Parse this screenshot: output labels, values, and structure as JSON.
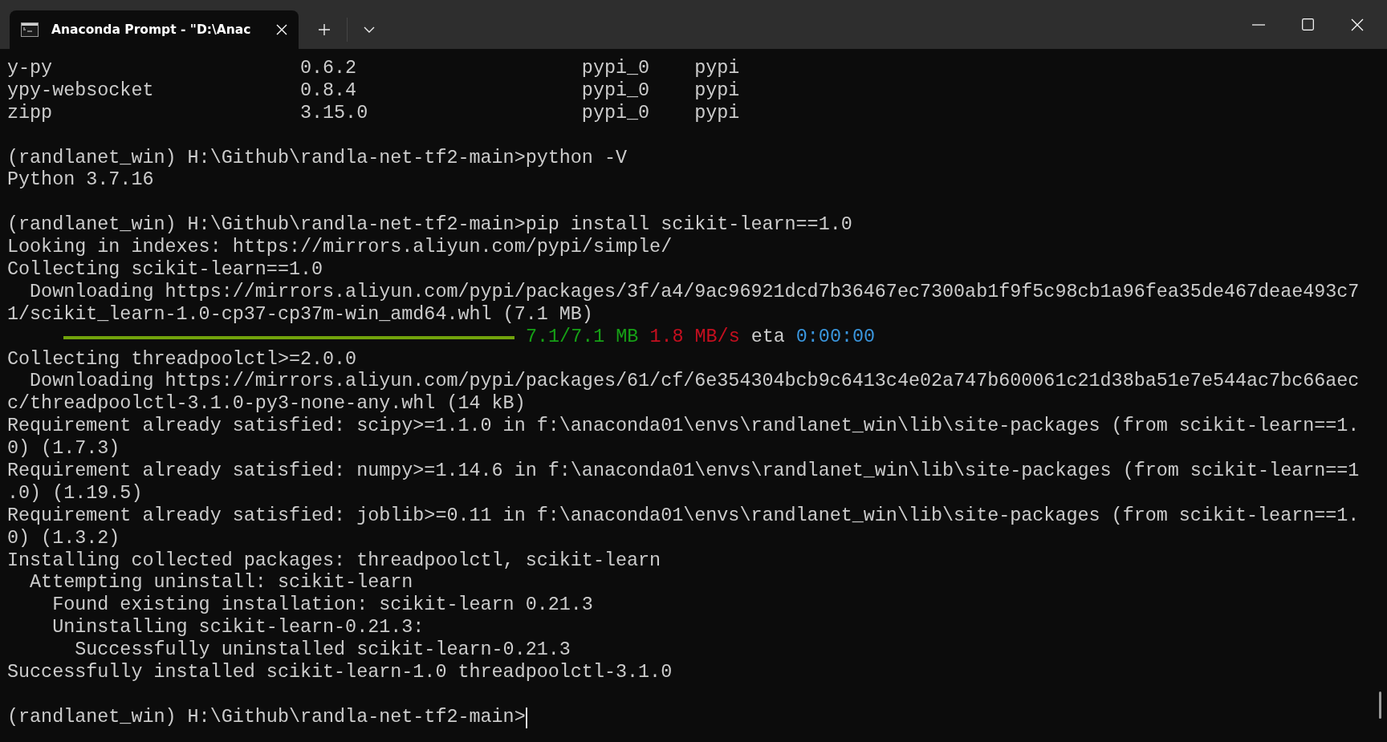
{
  "tabs": [
    {
      "title": "Anaconda Prompt - \"D:\\Anac",
      "selected": true
    }
  ],
  "terminal": {
    "lines": [
      {
        "kind": "text",
        "text": "y-py                      0.6.2                    pypi_0    pypi"
      },
      {
        "kind": "text",
        "text": "ypy-websocket             0.8.4                    pypi_0    pypi"
      },
      {
        "kind": "text",
        "text": "zipp                      3.15.0                   pypi_0    pypi"
      },
      {
        "kind": "blank"
      },
      {
        "kind": "text",
        "text": "(randlanet_win) H:\\Github\\randla-net-tf2-main>python -V"
      },
      {
        "kind": "text",
        "text": "Python 3.7.16"
      },
      {
        "kind": "blank"
      },
      {
        "kind": "text",
        "text": "(randlanet_win) H:\\Github\\randla-net-tf2-main>pip install scikit-learn==1.0"
      },
      {
        "kind": "text",
        "text": "Looking in indexes: https://mirrors.aliyun.com/pypi/simple/"
      },
      {
        "kind": "text",
        "text": "Collecting scikit-learn==1.0"
      },
      {
        "kind": "text",
        "text": "  Downloading https://mirrors.aliyun.com/pypi/packages/3f/a4/9ac96921dcd7b36467ec7300ab1f9f5c98cb1a96fea35de467deae493c7"
      },
      {
        "kind": "text",
        "text": "1/scikit_learn-1.0-cp37-cp37m-win_amd64.whl (7.1 MB)"
      },
      {
        "kind": "progress",
        "level": 1,
        "done": "7.1/7.1 MB",
        "speed": "1.8 MB/s",
        "eta_label": "eta",
        "eta": "0:00:00"
      },
      {
        "kind": "text",
        "text": "Collecting threadpoolctl>=2.0.0"
      },
      {
        "kind": "text",
        "text": "  Downloading https://mirrors.aliyun.com/pypi/packages/61/cf/6e354304bcb9c6413c4e02a747b600061c21d38ba51e7e544ac7bc66aec"
      },
      {
        "kind": "text",
        "text": "c/threadpoolctl-3.1.0-py3-none-any.whl (14 kB)"
      },
      {
        "kind": "text",
        "text": "Requirement already satisfied: scipy>=1.1.0 in f:\\anaconda01\\envs\\randlanet_win\\lib\\site-packages (from scikit-learn==1."
      },
      {
        "kind": "text",
        "text": "0) (1.7.3)"
      },
      {
        "kind": "text",
        "text": "Requirement already satisfied: numpy>=1.14.6 in f:\\anaconda01\\envs\\randlanet_win\\lib\\site-packages (from scikit-learn==1"
      },
      {
        "kind": "text",
        "text": ".0) (1.19.5)"
      },
      {
        "kind": "text",
        "text": "Requirement already satisfied: joblib>=0.11 in f:\\anaconda01\\envs\\randlanet_win\\lib\\site-packages (from scikit-learn==1."
      },
      {
        "kind": "text",
        "text": "0) (1.3.2)"
      },
      {
        "kind": "text",
        "text": "Installing collected packages: threadpoolctl, scikit-learn"
      },
      {
        "kind": "text",
        "text": "  Attempting uninstall: scikit-learn"
      },
      {
        "kind": "text",
        "text": "    Found existing installation: scikit-learn 0.21.3"
      },
      {
        "kind": "text",
        "text": "    Uninstalling scikit-learn-0.21.3:"
      },
      {
        "kind": "text",
        "text": "      Successfully uninstalled scikit-learn-0.21.3"
      },
      {
        "kind": "text",
        "text": "Successfully installed scikit-learn-1.0 threadpoolctl-3.1.0"
      },
      {
        "kind": "blank"
      },
      {
        "kind": "prompt",
        "text": "(randlanet_win) H:\\Github\\randla-net-tf2-main>"
      }
    ]
  }
}
